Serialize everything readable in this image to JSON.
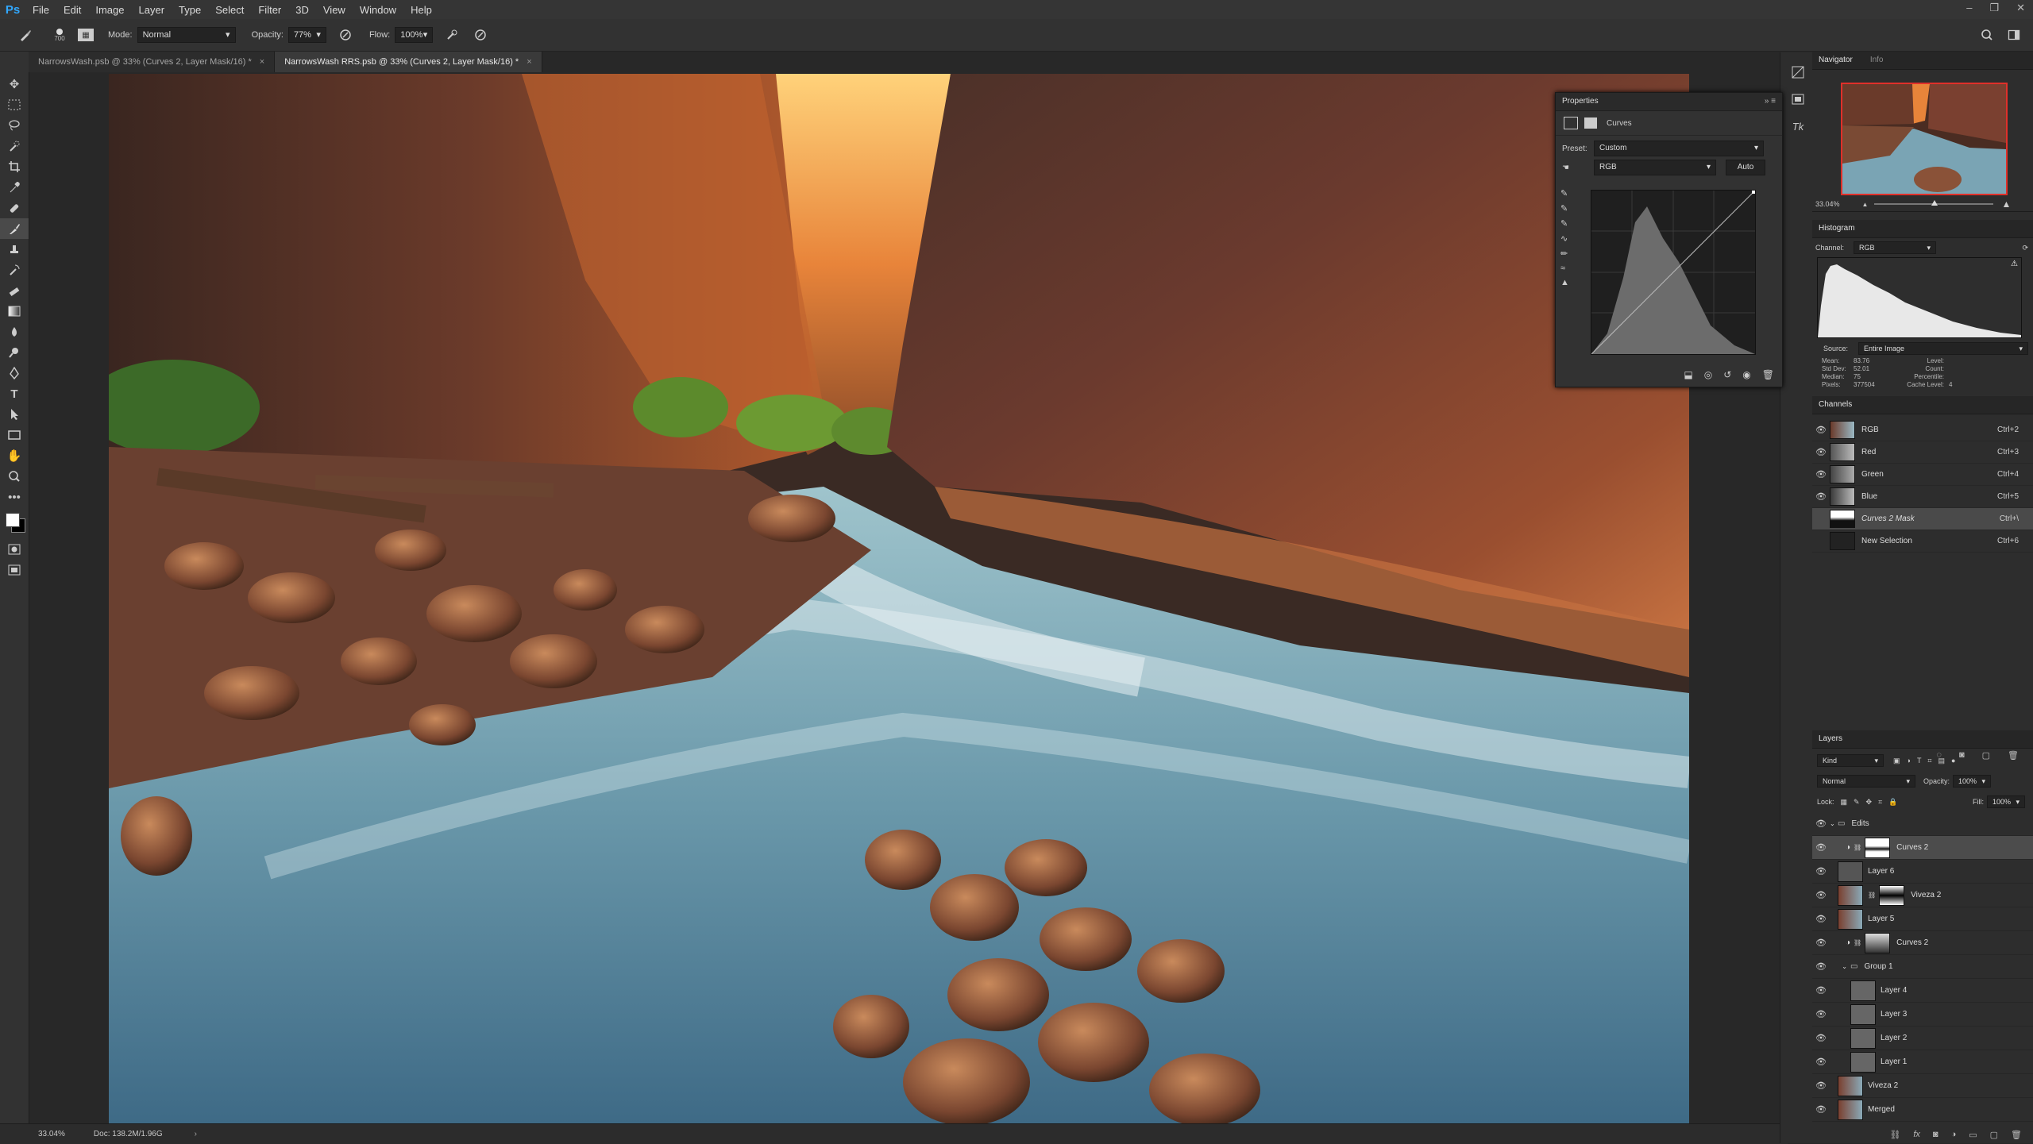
{
  "app": {
    "logo": "Ps",
    "menu": [
      "File",
      "Edit",
      "Image",
      "Layer",
      "Type",
      "Select",
      "Filter",
      "3D",
      "View",
      "Window",
      "Help"
    ],
    "window_controls": [
      "–",
      "❐",
      "✕"
    ]
  },
  "options": {
    "brush_size": "700",
    "mode_label": "Mode:",
    "mode_value": "Normal",
    "opacity_label": "Opacity:",
    "opacity_value": "77%",
    "flow_label": "Flow:",
    "flow_value": "100%"
  },
  "tabs": [
    {
      "label": "NarrowsWash.psb @ 33% (Curves 2, Layer Mask/16) *"
    },
    {
      "label": "NarrowsWash RRS.psb @ 33% (Curves 2, Layer Mask/16) *"
    }
  ],
  "status": {
    "zoom": "33.04%",
    "doc": "Doc: 138.2M/1.96G"
  },
  "properties": {
    "title": "Properties",
    "adjustment": "Curves",
    "preset_label": "Preset:",
    "preset_value": "Custom",
    "channel_value": "RGB",
    "auto_label": "Auto"
  },
  "navigator": {
    "tab": "Navigator",
    "tab2": "Info",
    "zoom": "33.04%"
  },
  "histogram": {
    "title": "Histogram",
    "channel_label": "Channel:",
    "channel_value": "RGB",
    "source_label": "Source:",
    "source_value": "Entire Image",
    "stats": {
      "mean_label": "Mean:",
      "mean": "83.76",
      "std_label": "Std Dev:",
      "std": "52.01",
      "median_label": "Median:",
      "median": "75",
      "pixels_label": "Pixels:",
      "pixels": "377504",
      "level_label": "Level:",
      "count_label": "Count:",
      "percentile_label": "Percentile:",
      "cache_label": "Cache Level:",
      "cache": "4"
    }
  },
  "channels": {
    "title": "Channels",
    "items": [
      {
        "name": "RGB",
        "shortcut": "Ctrl+2"
      },
      {
        "name": "Red",
        "shortcut": "Ctrl+3"
      },
      {
        "name": "Green",
        "shortcut": "Ctrl+4"
      },
      {
        "name": "Blue",
        "shortcut": "Ctrl+5"
      },
      {
        "name": "Curves 2 Mask",
        "shortcut": "Ctrl+\\"
      },
      {
        "name": "New Selection",
        "shortcut": "Ctrl+6"
      }
    ]
  },
  "layers": {
    "title": "Layers",
    "kind_label": "Kind",
    "blend_value": "Normal",
    "opacity_label": "Opacity:",
    "opacity_value": "100%",
    "lock_label": "Lock:",
    "fill_label": "Fill:",
    "fill_value": "100%",
    "items": [
      {
        "name": "Edits"
      },
      {
        "name": "Curves 2"
      },
      {
        "name": "Layer 6"
      },
      {
        "name": "Viveza 2"
      },
      {
        "name": "Layer 5"
      },
      {
        "name": "Curves 2"
      },
      {
        "name": "Group 1"
      },
      {
        "name": "Layer 4"
      },
      {
        "name": "Layer 3"
      },
      {
        "name": "Layer 2"
      },
      {
        "name": "Layer 1"
      },
      {
        "name": "Viveza 2"
      },
      {
        "name": "Merged"
      }
    ]
  },
  "colors": {
    "accent": "#31a8ff",
    "nav_frame": "#e0302a"
  }
}
